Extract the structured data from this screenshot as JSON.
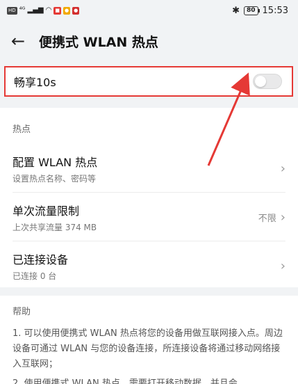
{
  "statusbar": {
    "signal_label": "⁴ᴳ",
    "bluetooth": "✱",
    "battery": "80",
    "time": "15:53"
  },
  "header": {
    "back_icon": "←",
    "title": "便携式 WLAN 热点"
  },
  "share": {
    "label": "畅享10s",
    "enabled": false
  },
  "hotspot_section": {
    "title": "热点",
    "items": [
      {
        "title": "配置 WLAN 热点",
        "subtitle": "设置热点名称、密码等",
        "value": ""
      },
      {
        "title": "单次流量限制",
        "subtitle": "上次共享流量 374 MB",
        "value": "不限"
      },
      {
        "title": "已连接设备",
        "subtitle": "已连接 0 台",
        "value": ""
      }
    ]
  },
  "help_section": {
    "title": "帮助",
    "paragraphs": [
      "1. 可以使用便携式 WLAN 热点将您的设备用做互联网接入点。周边设备可通过 WLAN 与您的设备连接，所连接设备将通过移动网络接入互联网；",
      "2. 使用便携式 WLAN 热点，需要打开移动数据，并且会"
    ]
  },
  "colors": {
    "highlight": "#e53935",
    "background": "#f1f3f5"
  }
}
